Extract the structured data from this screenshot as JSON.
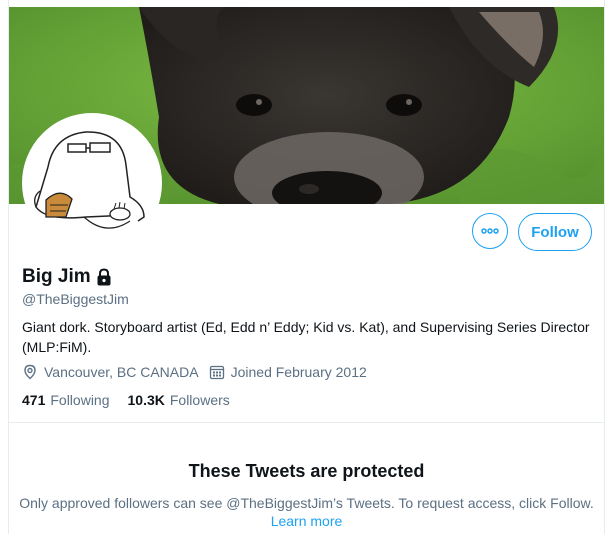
{
  "profile": {
    "name": "Big Jim",
    "handle": "@TheBiggestJim",
    "bio": "Giant dork. Storyboard artist (Ed, Edd n’ Eddy; Kid vs. Kat), and Supervising Series Director (MLP:FiM).",
    "location": "Vancouver, BC CANADA",
    "joined": "Joined February 2012",
    "protected": true,
    "banner_subject": "dog-photo",
    "avatar_subject": "cartoon-sketch"
  },
  "actions": {
    "more_icon": "more-dots-icon",
    "follow_label": "Follow"
  },
  "stats": {
    "following_count": "471",
    "following_label": "Following",
    "followers_count": "10.3K",
    "followers_label": "Followers"
  },
  "notice": {
    "title": "These Tweets are protected",
    "text": "Only approved followers can see @TheBiggestJim’s Tweets. To request access, click Follow.",
    "link": "Learn more"
  },
  "colors": {
    "accent": "#1da1f2",
    "secondary_text": "#5b7083",
    "primary_text": "#0f1419",
    "divider": "#e6ecf0"
  }
}
